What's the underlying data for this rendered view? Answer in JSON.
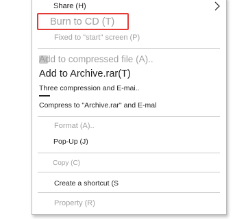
{
  "menu": {
    "share_label": "Share (H)",
    "burn_label": "Burn to CD (T)",
    "fixed_label": "Fixed to \"start\" screen (P)",
    "add_compressed_label": "Add to compressed file (A)..",
    "add_archive_label": "Add to Archive.rar(T)",
    "three_compression_label": "Three compression and E-mai..",
    "compress_email_label": "Compress to \"Archive.rar\" and E-mal",
    "format_label": "Format (A)..",
    "popup_label": "Pop-Up (J)",
    "copy_label": "Copy (C)",
    "shortcut_label": "Create a shortcut (S",
    "property_label": "Property (R)"
  },
  "colors": {
    "highlight_border": "#e53935",
    "disabled_text": "#a0a0a0",
    "text": "#222222",
    "separator": "#c8c8c8"
  },
  "icons": {
    "submenu_arrow": "chevron-right-icon"
  }
}
